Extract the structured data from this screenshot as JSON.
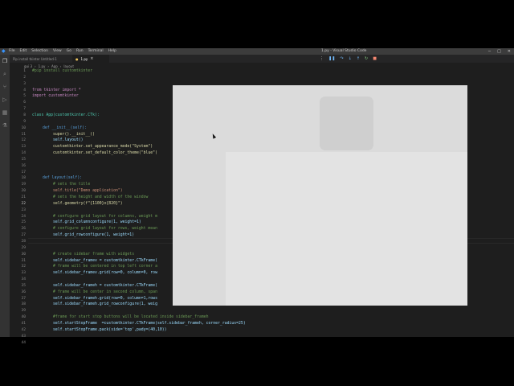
{
  "titlebar": {
    "menu": [
      "File",
      "Edit",
      "Selection",
      "View",
      "Go",
      "Run",
      "Terminal",
      "Help"
    ],
    "title": "1.py - Visual Studio Code"
  },
  "tabs": [
    {
      "label": "Pip install tkinter Untitled-1",
      "active": false
    },
    {
      "label": "1.py",
      "active": true
    }
  ],
  "breadcrumb": [
    "gui 3",
    "1.py",
    "App",
    "layout"
  ],
  "editor": {
    "current_line": "22",
    "lines": [
      {
        "n": "1",
        "text": "#pip install customtkinter",
        "color": "#6a9955",
        "indent": 0
      },
      {
        "n": "2",
        "text": "",
        "color": "#d4d4d4",
        "indent": 0
      },
      {
        "n": "3",
        "text": "",
        "color": "#d4d4d4",
        "indent": 0
      },
      {
        "n": "4",
        "text": "from tkinter import *",
        "color": "#c586c0",
        "indent": 0
      },
      {
        "n": "5",
        "text": "import customtkinter",
        "color": "#c586c0",
        "indent": 0
      },
      {
        "n": "6",
        "text": "",
        "color": "#d4d4d4",
        "indent": 0
      },
      {
        "n": "7",
        "text": "",
        "color": "#d4d4d4",
        "indent": 0
      },
      {
        "n": "8",
        "text": "class App(customtkinter.CTk):",
        "color": "#4ec9b0",
        "indent": 0
      },
      {
        "n": "9",
        "text": "",
        "color": "#d4d4d4",
        "indent": 0
      },
      {
        "n": "10",
        "text": "def __init__(self):",
        "color": "#569cd6",
        "indent": 1
      },
      {
        "n": "11",
        "text": "super().__init__()",
        "color": "#dcdcaa",
        "indent": 2
      },
      {
        "n": "12",
        "text": "self.layout()",
        "color": "#9cdcfe",
        "indent": 2
      },
      {
        "n": "13",
        "text": "customtkinter.set_appearance_mode(\"System\")",
        "color": "#dcdcaa",
        "indent": 2
      },
      {
        "n": "14",
        "text": "customtkinter.set_default_color_theme(\"blue\")",
        "color": "#dcdcaa",
        "indent": 2
      },
      {
        "n": "15",
        "text": "",
        "color": "#d4d4d4",
        "indent": 0
      },
      {
        "n": "16",
        "text": "",
        "color": "#d4d4d4",
        "indent": 0
      },
      {
        "n": "17",
        "text": "",
        "color": "#d4d4d4",
        "indent": 0
      },
      {
        "n": "18",
        "text": "def layout(self):",
        "color": "#569cd6",
        "indent": 1
      },
      {
        "n": "19",
        "text": "# sets the title",
        "color": "#6a9955",
        "indent": 2
      },
      {
        "n": "20",
        "text": "self.title(\"Demo application\")",
        "color": "#ce9178",
        "indent": 2
      },
      {
        "n": "21",
        "text": "# sets the height and width of the window",
        "color": "#6a9955",
        "indent": 2
      },
      {
        "n": "22",
        "text": "self.geometry(f\"{1100}x{820}\")",
        "color": "#dcdcaa",
        "indent": 2
      },
      {
        "n": "23",
        "text": "",
        "color": "#d4d4d4",
        "indent": 0
      },
      {
        "n": "24",
        "text": "# configure grid layout for columns, weight m",
        "color": "#6a9955",
        "indent": 2
      },
      {
        "n": "25",
        "text": "self.grid_columnconfigure(1, weight=1)",
        "color": "#9cdcfe",
        "indent": 2
      },
      {
        "n": "26",
        "text": "# configure grid layout for rows, weight mean",
        "color": "#6a9955",
        "indent": 2
      },
      {
        "n": "27",
        "text": "self.grid_rowconfigure(1, weight=1)",
        "color": "#9cdcfe",
        "indent": 2
      },
      {
        "n": "28",
        "text": "",
        "color": "#d4d4d4",
        "indent": 0
      },
      {
        "n": "29",
        "text": "",
        "color": "#d4d4d4",
        "indent": 0
      },
      {
        "n": "30",
        "text": "# create sidebar frame with widgets",
        "color": "#6a9955",
        "indent": 2
      },
      {
        "n": "31",
        "text": "self.sidebar_framev = customtkinter.CTkFrame(",
        "color": "#9cdcfe",
        "indent": 2
      },
      {
        "n": "32",
        "text": "# frame will be centered in top left corner a",
        "color": "#6a9955",
        "indent": 2
      },
      {
        "n": "33",
        "text": "self.sidebar_framev.grid(row=0, column=0, row",
        "color": "#9cdcfe",
        "indent": 2
      },
      {
        "n": "34",
        "text": "",
        "color": "#d4d4d4",
        "indent": 0
      },
      {
        "n": "35",
        "text": "self.sidebar_frameh = customtkinter.CTkFrame(",
        "color": "#9cdcfe",
        "indent": 2
      },
      {
        "n": "36",
        "text": "# frame will be center in second column, span",
        "color": "#6a9955",
        "indent": 2
      },
      {
        "n": "37",
        "text": "self.sidebar_frameh.grid(row=0, column=1,rows",
        "color": "#9cdcfe",
        "indent": 2
      },
      {
        "n": "38",
        "text": "self.sidebar_frameh.grid_rowconfigure(1, weig",
        "color": "#9cdcfe",
        "indent": 2
      },
      {
        "n": "39",
        "text": "",
        "color": "#d4d4d4",
        "indent": 0
      },
      {
        "n": "40",
        "text": "#frame for start stop buttons will be located inside sidebar_frameh",
        "color": "#6a9955",
        "indent": 2
      },
      {
        "n": "41",
        "text": "self.startStopFrame  =customtkinter.CTkFrame(self.sidebar_frameh, corner_radius=25)",
        "color": "#9cdcfe",
        "indent": 2
      },
      {
        "n": "42",
        "text": "self.startStopFrame.pack(side='top',pady=(40,10))",
        "color": "#9cdcfe",
        "indent": 2
      },
      {
        "n": "43",
        "text": "",
        "color": "#d4d4d4",
        "indent": 0
      },
      {
        "n": "44",
        "text": "",
        "color": "#d4d4d4",
        "indent": 0
      }
    ]
  },
  "colors": {
    "editor_bg": "#1e1e1e",
    "app_window_bg": "#d9d9d9",
    "app_card": "#cfcfcf",
    "app_main_frame": "#e3e3e3"
  }
}
